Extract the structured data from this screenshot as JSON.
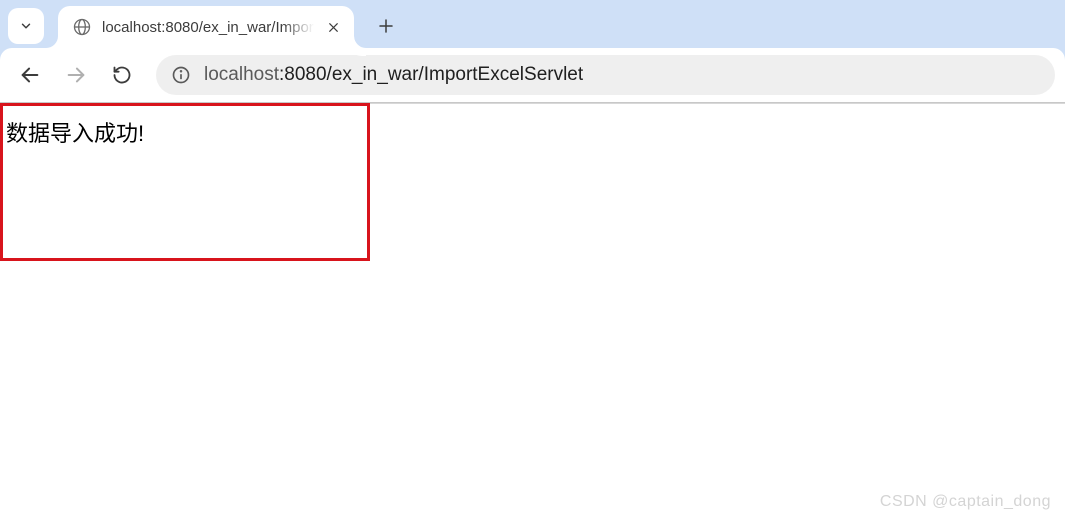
{
  "tabs": {
    "active": {
      "title": "localhost:8080/ex_in_war/Impor"
    }
  },
  "address": {
    "host_gray": "localhost",
    "host_rest": ":8080/ex_in_war/ImportExcelServlet"
  },
  "page": {
    "message": "数据导入成功!"
  },
  "watermark": "CSDN @captain_dong"
}
